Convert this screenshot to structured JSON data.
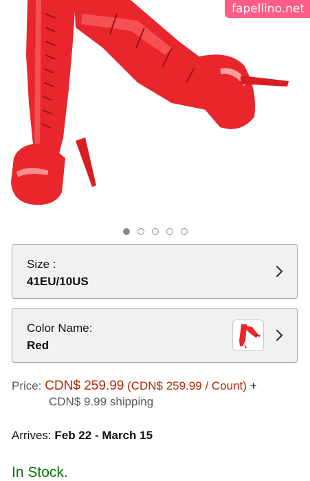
{
  "watermark": "fapellino.net",
  "carousel": {
    "count": 5,
    "active": 0
  },
  "size": {
    "label": "Size :",
    "value": "41EU/10US"
  },
  "color": {
    "label": "Color Name:",
    "value": "Red"
  },
  "price": {
    "label": "Price:",
    "main": "CDN$ 259.99",
    "unit": "(CDN$ 259.99 / Count)",
    "plus": "+",
    "shipping": "CDN$ 9.99 shipping"
  },
  "arrives": {
    "label": "Arrives:",
    "dates": "Feb 22 - March 15"
  },
  "stock": "In Stock.",
  "colors": {
    "boot": "#e8262b",
    "price": "#b12704",
    "in_stock": "#007600",
    "box_bg": "#f0f2f2"
  }
}
